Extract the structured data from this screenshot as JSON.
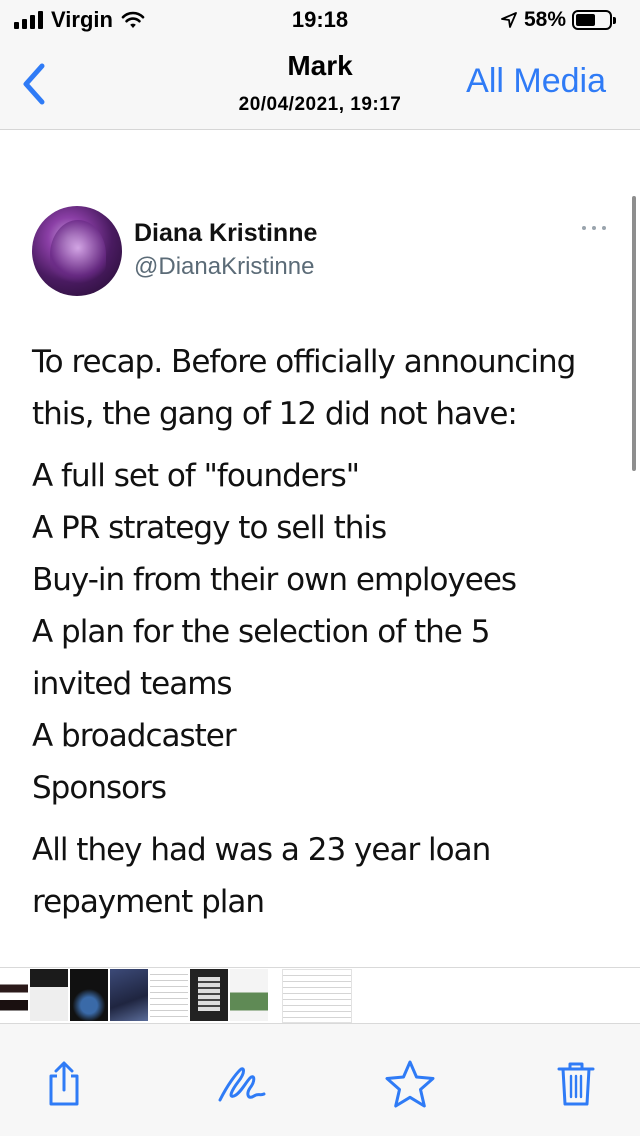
{
  "status_bar": {
    "carrier": "Virgin",
    "time": "19:18",
    "battery_percent": "58%",
    "signal_bars": 4,
    "battery_level": 0.58,
    "icons": [
      "signal-icon",
      "wifi-icon",
      "location-arrow-icon",
      "battery-icon"
    ]
  },
  "nav": {
    "back_icon": "chevron-left-icon",
    "title": "Mark",
    "subtitle": "20/04/2021, 19:17",
    "all_media_label": "All Media"
  },
  "tweet": {
    "author_name": "Diana Kristinne",
    "author_handle": "@DianaKristinne",
    "more_icon": "ellipsis-icon",
    "paragraphs": [
      {
        "lines": [
          "To recap. Before officially announcing",
          "this, the gang of 12 did not have:"
        ]
      },
      {
        "lines": [
          "A full set of \"founders\"",
          "A PR strategy to sell this",
          "Buy-in from their own employees",
          "A plan for the selection of the 5",
          "invited teams",
          "A broadcaster",
          "Sponsors"
        ]
      },
      {
        "lines": [
          "All they had was a 23 year loan",
          "repayment plan"
        ]
      }
    ]
  },
  "thumbnails": {
    "count": 9,
    "selected_index": 8
  },
  "toolbar": {
    "share_icon": "share-icon",
    "markup_icon": "markup-pen-icon",
    "favorite_icon": "star-icon",
    "delete_icon": "trash-icon"
  },
  "colors": {
    "accent": "#2f7bf6",
    "handle_gray": "#5b6b77",
    "bar_background": "#f7f7f7"
  }
}
